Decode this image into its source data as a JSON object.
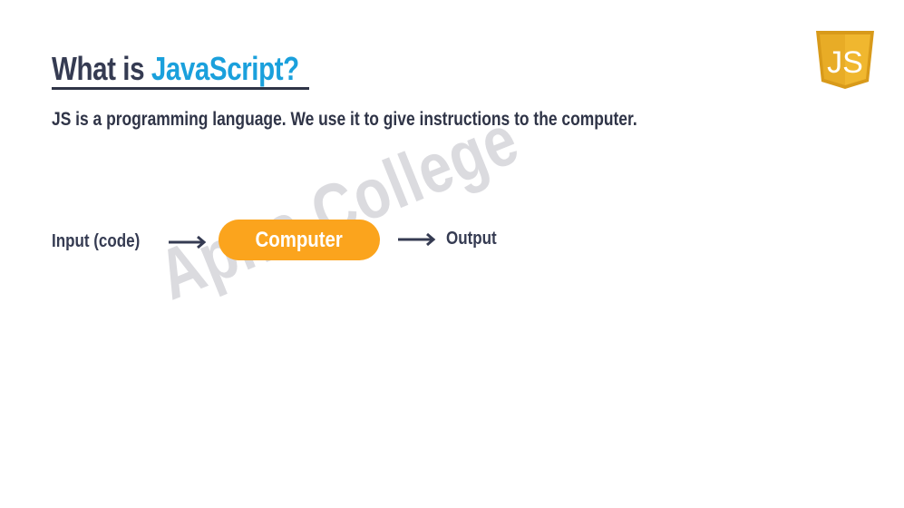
{
  "slide": {
    "title_prefix": "What is ",
    "title_highlight": "JavaScript?",
    "subtitle": "JS is a programming language. We use it to give instructions to the computer.",
    "logo_text": "JS",
    "watermark": "Apna College"
  },
  "flow": {
    "input_label": "Input (code)",
    "process_label": "Computer",
    "output_label": "Output"
  },
  "colors": {
    "title_dark": "#353b52",
    "title_accent": "#1aa0dc",
    "process_fill": "#fba41d",
    "logo_fill": "#f0b72f",
    "logo_edge": "#d89a1a"
  },
  "icons": {
    "logo": "js-shield-logo",
    "arrow": "arrow-right-icon"
  }
}
